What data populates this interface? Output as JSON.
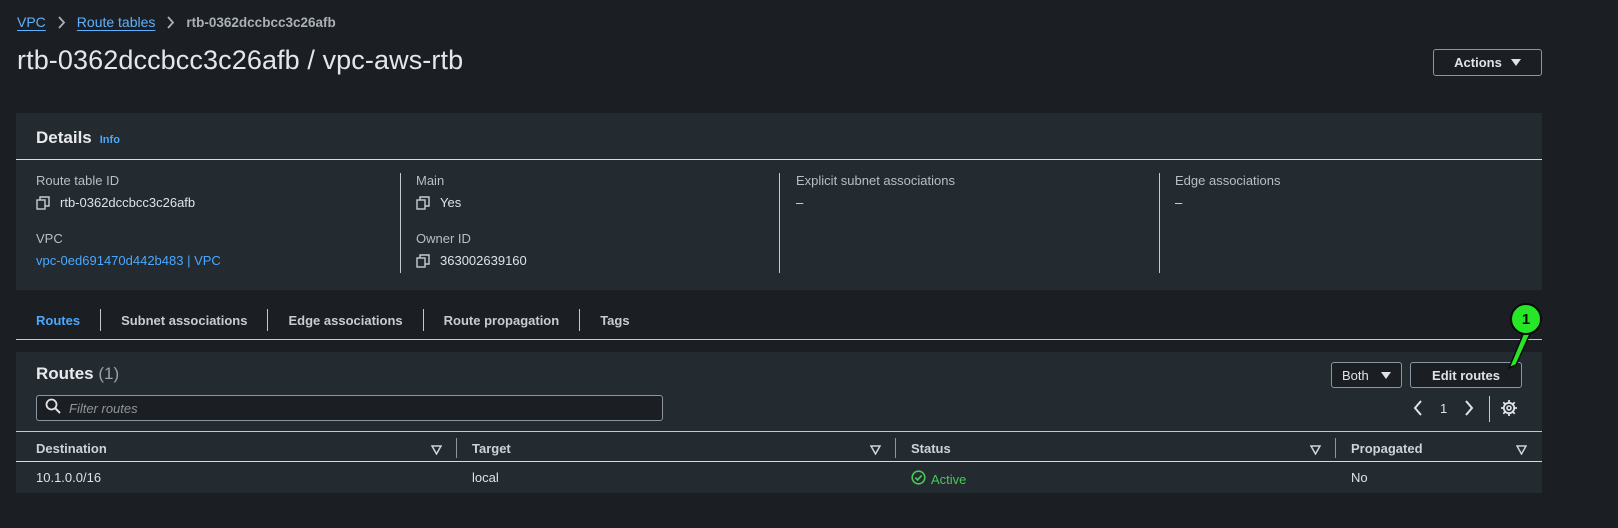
{
  "breadcrumb": {
    "items": [
      "VPC",
      "Route tables"
    ],
    "current": "rtb-0362dccbcc3c26afb"
  },
  "page": {
    "title": "rtb-0362dccbcc3c26afb / vpc-aws-rtb",
    "actions_label": "Actions"
  },
  "details": {
    "heading": "Details",
    "info": "Info",
    "route_table_id_label": "Route table ID",
    "route_table_id": "rtb-0362dccbcc3c26afb",
    "vpc_label": "VPC",
    "vpc_value": "vpc-0ed691470d442b483 | VPC",
    "main_label": "Main",
    "main_value": "Yes",
    "owner_label": "Owner ID",
    "owner_value": "363002639160",
    "explicit_label": "Explicit subnet associations",
    "explicit_value": "–",
    "edge_label": "Edge associations",
    "edge_value": "–"
  },
  "tabs": [
    "Routes",
    "Subnet associations",
    "Edge associations",
    "Route propagation",
    "Tags"
  ],
  "routes": {
    "title": "Routes",
    "count": "(1)",
    "filter_label": "Both",
    "edit_label": "Edit routes",
    "search_placeholder": "Filter routes",
    "page": "1",
    "columns": [
      "Destination",
      "Target",
      "Status",
      "Propagated"
    ],
    "rows": [
      {
        "destination": "10.1.0.0/16",
        "target": "local",
        "status": "Active",
        "propagated": "No"
      }
    ]
  },
  "annotation": {
    "label": "1",
    "color": "#27e527"
  },
  "colors": {
    "link": "#4aa8ff",
    "success": "#49c955",
    "background": "#1b1f23",
    "panel": "#232a30"
  },
  "icons": [
    "chevron-right-icon",
    "copy-icon",
    "search-icon",
    "chevron-left-icon",
    "gear-icon",
    "sort-down-icon",
    "status-success-icon",
    "caret-down-icon"
  ]
}
